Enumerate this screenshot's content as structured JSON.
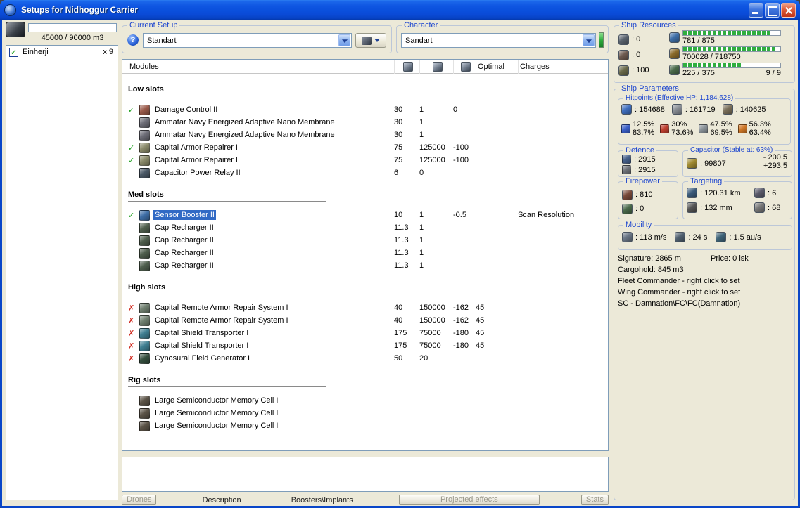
{
  "colors": {
    "accent": "#1c45cf",
    "selection": "#316ac5",
    "status_ok": "#1fa11f",
    "status_error": "#cf2a1f",
    "resource_fill": "#2fae3f"
  },
  "window": {
    "title": "Setups for Nidhoggur Carrier"
  },
  "left_panel": {
    "cargo_text": "45000 / 90000 m3",
    "ship_list": [
      {
        "label": "Einherji",
        "count": "x 9",
        "checked": true
      }
    ]
  },
  "current_setup": {
    "label": "Current Setup",
    "help_glyph": "?",
    "value": "Standart"
  },
  "character": {
    "label": "Character",
    "value": "Sandart"
  },
  "modules_table": {
    "title": "Modules",
    "columns": {
      "optimal": "Optimal",
      "charges": "Charges"
    },
    "sections": [
      {
        "title": "Low slots",
        "rows": [
          {
            "status": "ok",
            "icon": "damage-control",
            "name": "Damage Control II",
            "cpu": "30",
            "pg": "1",
            "cap": "0",
            "optimal": "",
            "charges": ""
          },
          {
            "status": "none",
            "icon": "membrane",
            "name": "Ammatar Navy Energized Adaptive Nano Membrane",
            "cpu": "30",
            "pg": "1",
            "cap": "",
            "optimal": "",
            "charges": ""
          },
          {
            "status": "none",
            "icon": "membrane",
            "name": "Ammatar Navy Energized Adaptive Nano Membrane",
            "cpu": "30",
            "pg": "1",
            "cap": "",
            "optimal": "",
            "charges": ""
          },
          {
            "status": "ok",
            "icon": "armor-repairer",
            "name": "Capital Armor Repairer I",
            "cpu": "75",
            "pg": "125000",
            "cap": "-100",
            "optimal": "",
            "charges": ""
          },
          {
            "status": "ok",
            "icon": "armor-repairer",
            "name": "Capital Armor Repairer I",
            "cpu": "75",
            "pg": "125000",
            "cap": "-100",
            "optimal": "",
            "charges": ""
          },
          {
            "status": "none",
            "icon": "power-relay",
            "name": "Capacitor Power Relay II",
            "cpu": "6",
            "pg": "0",
            "cap": "",
            "optimal": "",
            "charges": ""
          }
        ]
      },
      {
        "title": "Med slots",
        "rows": [
          {
            "status": "ok",
            "icon": "sensor-booster",
            "name": "Sensor Booster II",
            "cpu": "10",
            "pg": "1",
            "cap": "-0.5",
            "optimal": "",
            "charges": "Scan Resolution",
            "selected": true
          },
          {
            "status": "none",
            "icon": "cap-recharger",
            "name": "Cap Recharger II",
            "cpu": "11.3",
            "pg": "1",
            "cap": "",
            "optimal": "",
            "charges": ""
          },
          {
            "status": "none",
            "icon": "cap-recharger",
            "name": "Cap Recharger II",
            "cpu": "11.3",
            "pg": "1",
            "cap": "",
            "optimal": "",
            "charges": ""
          },
          {
            "status": "none",
            "icon": "cap-recharger",
            "name": "Cap Recharger II",
            "cpu": "11.3",
            "pg": "1",
            "cap": "",
            "optimal": "",
            "charges": ""
          },
          {
            "status": "none",
            "icon": "cap-recharger",
            "name": "Cap Recharger II",
            "cpu": "11.3",
            "pg": "1",
            "cap": "",
            "optimal": "",
            "charges": ""
          }
        ]
      },
      {
        "title": "High slots",
        "rows": [
          {
            "status": "error",
            "icon": "remote-armor-repair",
            "name": "Capital Remote Armor Repair System I",
            "cpu": "40",
            "pg": "150000",
            "cap": "-162",
            "optimal": "45",
            "charges": ""
          },
          {
            "status": "error",
            "icon": "remote-armor-repair",
            "name": "Capital Remote Armor Repair System I",
            "cpu": "40",
            "pg": "150000",
            "cap": "-162",
            "optimal": "45",
            "charges": ""
          },
          {
            "status": "error",
            "icon": "shield-transporter",
            "name": "Capital Shield Transporter I",
            "cpu": "175",
            "pg": "75000",
            "cap": "-180",
            "optimal": "45",
            "charges": ""
          },
          {
            "status": "error",
            "icon": "shield-transporter",
            "name": "Capital Shield Transporter I",
            "cpu": "175",
            "pg": "75000",
            "cap": "-180",
            "optimal": "45",
            "charges": ""
          },
          {
            "status": "error",
            "icon": "cyno-generator",
            "name": "Cynosural Field Generator I",
            "cpu": "50",
            "pg": "20",
            "cap": "",
            "optimal": "",
            "charges": ""
          }
        ]
      },
      {
        "title": "Rig slots",
        "rows": [
          {
            "status": "none",
            "icon": "rig",
            "name": "Large Semiconductor Memory Cell I",
            "cpu": "",
            "pg": "",
            "cap": "",
            "optimal": "",
            "charges": ""
          },
          {
            "status": "none",
            "icon": "rig",
            "name": "Large Semiconductor Memory Cell I",
            "cpu": "",
            "pg": "",
            "cap": "",
            "optimal": "",
            "charges": ""
          },
          {
            "status": "none",
            "icon": "rig",
            "name": "Large Semiconductor Memory Cell I",
            "cpu": "",
            "pg": "",
            "cap": "",
            "optimal": "",
            "charges": ""
          }
        ]
      }
    ]
  },
  "bottom_tabs": [
    {
      "label": "Drones",
      "style": "button"
    },
    {
      "label": "Description",
      "style": "flat"
    },
    {
      "label": "Boosters\\Implants",
      "style": "flat"
    },
    {
      "label": "Projected effects",
      "style": "button wide"
    },
    {
      "label": "Stats",
      "style": "button"
    }
  ],
  "ship_resources": {
    "label": "Ship Resources",
    "turrets": ": 0",
    "launchers": ": 0",
    "calibration": ": 100",
    "cpu": "781 / 875",
    "cpu_pct": 89,
    "powergrid": "700028 / 718750",
    "pg_pct": 97,
    "drone_bay": "225 / 375",
    "drone_pct": 60,
    "drones": "9 / 9"
  },
  "ship_parameters": {
    "label": "Ship Parameters",
    "hitpoints": {
      "label": "Hitpoints (Effective HP: 1,184,628)",
      "shield": ": 154688",
      "armor": ": 161719",
      "structure": ": 140625",
      "resists": [
        {
          "type": "em",
          "top": "12.5%",
          "bottom": "83.7%"
        },
        {
          "type": "thermal",
          "top": "30%",
          "bottom": "73.6%"
        },
        {
          "type": "kinetic",
          "top": "47.5%",
          "bottom": "69.5%"
        },
        {
          "type": "explosive",
          "top": "56.3%",
          "bottom": "63.4%"
        }
      ]
    },
    "defence": {
      "label": "Defence",
      "v1": ": 2915",
      "v2": ": 2915"
    },
    "capacitor": {
      "label": "Capacitor (Stable at: 63%)",
      "capacity": ": 99807",
      "usage": "- 200.5",
      "recharge": "+293.5"
    },
    "firepower": {
      "label": "Firepower",
      "dps": ": 810",
      "drones": ": 0"
    },
    "targeting": {
      "label": "Targeting",
      "range": ": 120.31 km",
      "max_targets": ": 6",
      "scan_res": ": 132 mm",
      "sensor_str": ": 68"
    },
    "mobility": {
      "label": "Mobility",
      "speed": ": 113 m/s",
      "align": ": 24 s",
      "warp": ": 1.5 au/s"
    },
    "info": {
      "signature": "Signature: 2865 m",
      "price": "Price: 0 isk",
      "cargohold": "Cargohold: 845 m3",
      "fleet": "Fleet Commander - right click to set",
      "wing": "Wing Commander - right click to set",
      "sc": "SC - Damnation\\FC\\FC(Damnation)"
    }
  }
}
